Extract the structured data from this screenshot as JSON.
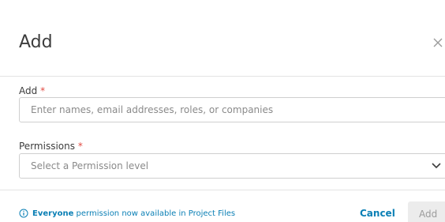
{
  "dialog": {
    "title": "Add",
    "close_icon": "close-icon"
  },
  "fields": {
    "add": {
      "label": "Add",
      "required_mark": "*",
      "placeholder": "Enter names, email addresses, roles, or companies"
    },
    "permissions": {
      "label": "Permissions",
      "required_mark": "*",
      "placeholder": "Select a Permission level",
      "icon": "chevron-down-icon"
    }
  },
  "footer": {
    "info_icon": "info-icon",
    "info_bold": "Everyone",
    "info_text": " permission now available in Project Files",
    "cancel_label": "Cancel",
    "add_label": "Add"
  },
  "colors": {
    "accent": "#0a7fb5",
    "required": "#e24b43",
    "disabled_bg": "#ececec"
  }
}
